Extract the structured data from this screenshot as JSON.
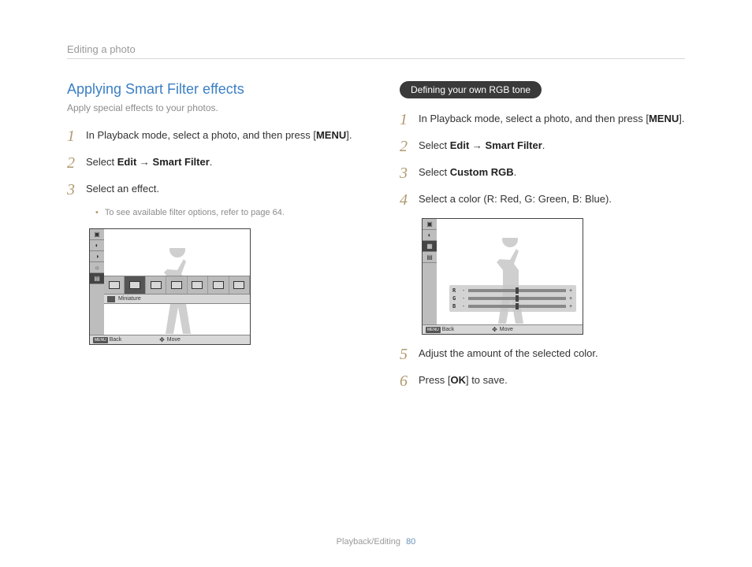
{
  "chapter": "Editing a photo",
  "left": {
    "title": "Applying Smart Filter effects",
    "subtitle": "Apply special effects to your photos.",
    "steps": [
      {
        "num": "1",
        "pre": "In Playback mode, select a photo, and then press [",
        "bold1": "MENU",
        "post": "]."
      },
      {
        "num": "2",
        "pre": "Select ",
        "bold1": "Edit",
        "mid": " → ",
        "bold2": "Smart Filter",
        "post": "."
      },
      {
        "num": "3",
        "pre": "Select an effect.",
        "bold1": "",
        "post": ""
      }
    ],
    "bullet": "To see available filter options, refer to page 64.",
    "cam": {
      "back": "Back",
      "move": "Move",
      "label": "Miniature",
      "menu": "MENU"
    }
  },
  "right": {
    "pill": "Defining your own RGB tone",
    "steps": [
      {
        "num": "1",
        "pre": "In Playback mode, select a photo, and then press [",
        "bold1": "MENU",
        "post": "]."
      },
      {
        "num": "2",
        "pre": "Select ",
        "bold1": "Edit",
        "mid": " → ",
        "bold2": "Smart Filter",
        "post": "."
      },
      {
        "num": "3",
        "pre": "Select ",
        "bold1": "Custom RGB",
        "post": "."
      },
      {
        "num": "4",
        "pre": "Select a color (R: Red, G: Green, B: Blue).",
        "bold1": "",
        "post": ""
      }
    ],
    "steps2": [
      {
        "num": "5",
        "pre": "Adjust the amount of the selected color.",
        "bold1": "",
        "post": ""
      },
      {
        "num": "6",
        "pre": "Press [",
        "bold1": "OK",
        "post": "] to save."
      }
    ],
    "cam": {
      "back": "Back",
      "move": "Move",
      "menu": "MENU",
      "rgb": {
        "r": "R",
        "g": "G",
        "b": "B",
        "neg": "-",
        "pos": "+"
      }
    }
  },
  "footer": {
    "section": "Playback/Editing",
    "page": "80"
  }
}
